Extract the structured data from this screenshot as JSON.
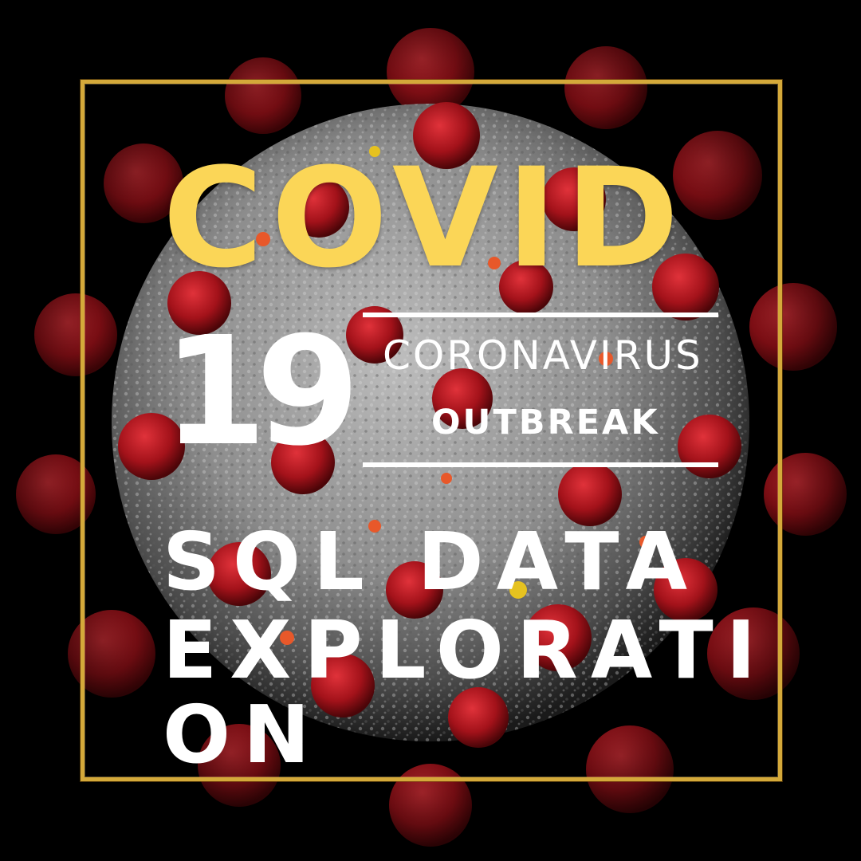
{
  "headline": {
    "word": "COVID",
    "number": "19"
  },
  "subtitle": {
    "line1": "CORONAVIRUS",
    "line2": "OUTBREAK"
  },
  "project_title": {
    "lines": [
      "SQL DATA",
      "EXPLORATI",
      "ON"
    ]
  },
  "colors": {
    "headline": "#fbd657",
    "frame": "#d4a93a",
    "text": "#ffffff",
    "background": "#000000",
    "spike": "#b3151b"
  },
  "icons": {
    "background_illustration": "coronavirus-illustration"
  }
}
